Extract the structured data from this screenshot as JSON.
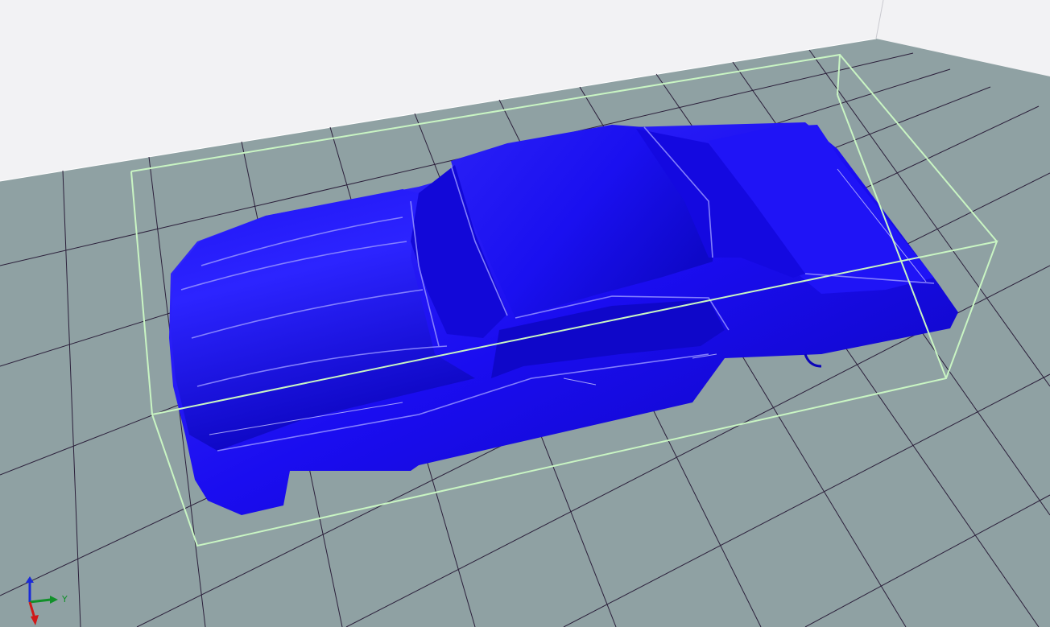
{
  "viewport": {
    "background_color": "#f2f2f4",
    "build_plate_color": "#8fa1a3",
    "grid_line_color": "#2b1f3a",
    "bounding_box_color": "#c9f5c3",
    "model_color": "#1a0df0",
    "model_name": "car-body"
  },
  "axes": {
    "x_color": "#d01818",
    "y_color": "#11902a",
    "z_color": "#1a2ad8",
    "y_label": "Y"
  }
}
